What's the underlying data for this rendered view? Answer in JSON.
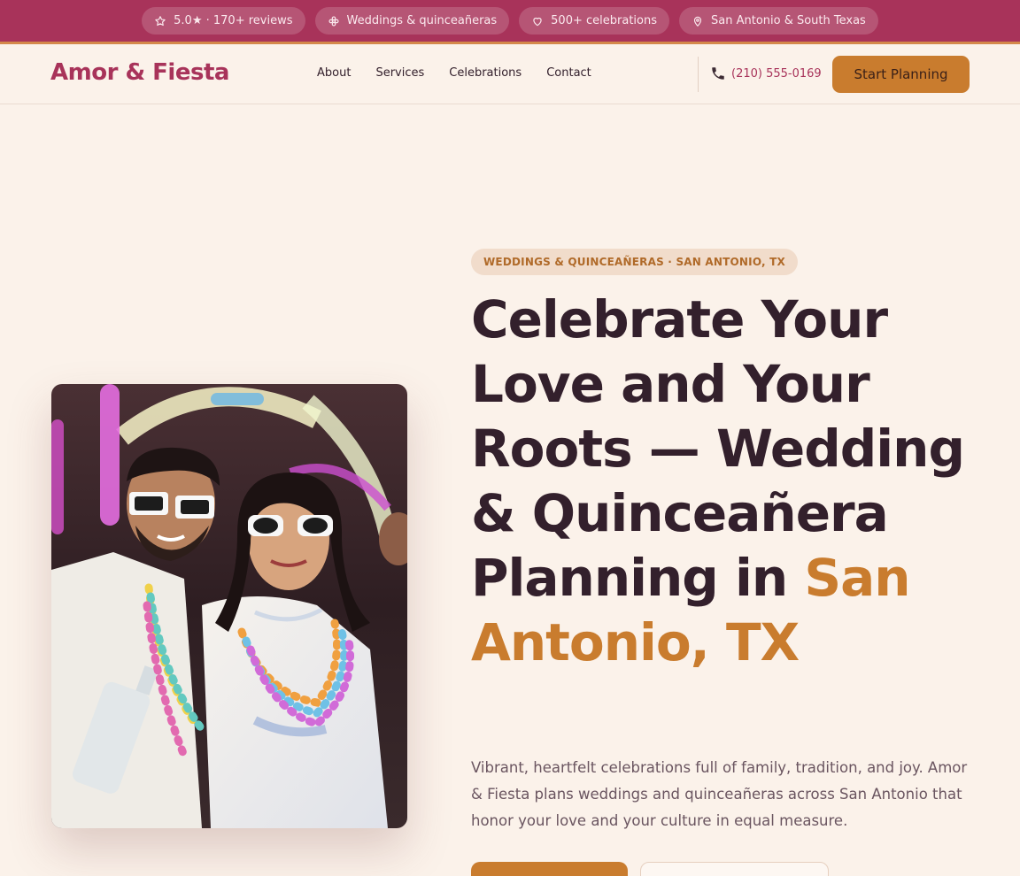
{
  "topbar": {
    "badges": [
      {
        "icon": "star-icon",
        "text": "5.0★ · 170+ reviews"
      },
      {
        "icon": "flower-icon",
        "text": "Weddings & quinceañeras"
      },
      {
        "icon": "heart-icon",
        "text": "500+ celebrations"
      },
      {
        "icon": "location-pin-icon",
        "text": "San Antonio & South Texas"
      }
    ]
  },
  "nav": {
    "logo": "Amor & Fiesta",
    "links": [
      "About",
      "Services",
      "Celebrations",
      "Contact"
    ],
    "phone": "(210) 555-0169",
    "cta": "Start Planning"
  },
  "hero": {
    "eyebrow": "WEDDINGS & QUINCEAÑERAS · SAN ANTONIO, TX",
    "headline": "Celebrate Your Love and Your Roots — Wedding & Quinceañera Planning in",
    "headline_accent": "San Antonio, TX",
    "lede": "Vibrant, heartfelt celebrations full of family, tradition, and joy. Amor & Fiesta plans weddings and quinceañeras across San Antonio that honor your love and your culture in equal measure."
  },
  "colors": {
    "brand": "#a8335a",
    "accent": "#c97c2e",
    "background": "#fbf2ea",
    "text": "#33202c"
  }
}
